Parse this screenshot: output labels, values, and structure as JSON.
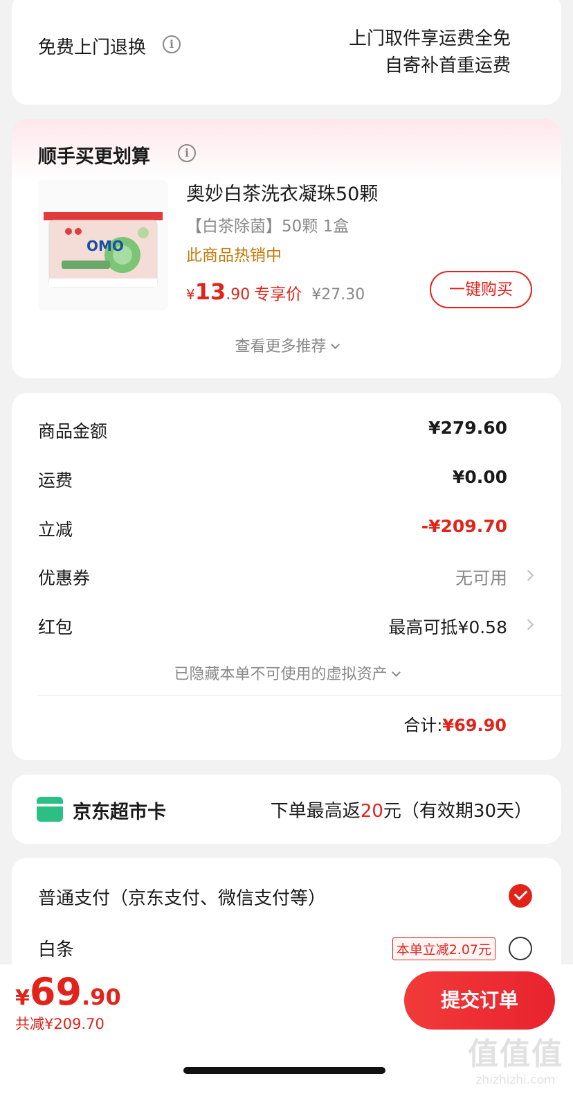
{
  "return_service": {
    "label": "免费上门退换",
    "line1": "上门取件享运费全免",
    "line2": "自寄补首重运费"
  },
  "recommend": {
    "title": "顺手买更划算",
    "product": {
      "name": "奥妙白茶洗衣凝珠50颗",
      "spec": "【白茶除菌】50颗 1盒",
      "hot": "此商品热销中",
      "price_symbol": "¥",
      "price_int": "13",
      "price_dec": ".90",
      "price_tag": "专享价",
      "old_price": "¥27.30",
      "buy_label": "一键购买",
      "image_brand": "OMO"
    },
    "more_label": "查看更多推荐"
  },
  "summary": {
    "rows": [
      {
        "label": "商品金额",
        "value": "¥279.60"
      },
      {
        "label": "运费",
        "value": "¥0.00"
      },
      {
        "label": "立减",
        "value": "-¥209.70"
      },
      {
        "label": "优惠券",
        "value": "无可用"
      },
      {
        "label": "红包",
        "value": "最高可抵¥0.58"
      }
    ],
    "hidden_label": "已隐藏本单不可使用的虚拟资产",
    "total_label": "合计:",
    "total_value": "¥69.90"
  },
  "jd_card": {
    "title": "京东超市卡",
    "desc_pre": "下单最高返",
    "desc_amount": "20",
    "desc_post": "元（有效期30天）"
  },
  "payment": {
    "normal_label": "普通支付（京东支付、微信支付等）",
    "baitiao_label": "白条",
    "baitiao_tag": "本单立减2.07元"
  },
  "bottom": {
    "price_symbol": "¥",
    "price_int": "69",
    "price_dec": ".90",
    "saved": "共减¥209.70",
    "submit_label": "提交订单"
  },
  "watermark": {
    "main": "值值值",
    "sub": "zhizhizhi.com"
  },
  "colors": {
    "accent": "#e2231a",
    "hot": "#c47a0c",
    "jd_card_icon": "#2cbf84"
  }
}
